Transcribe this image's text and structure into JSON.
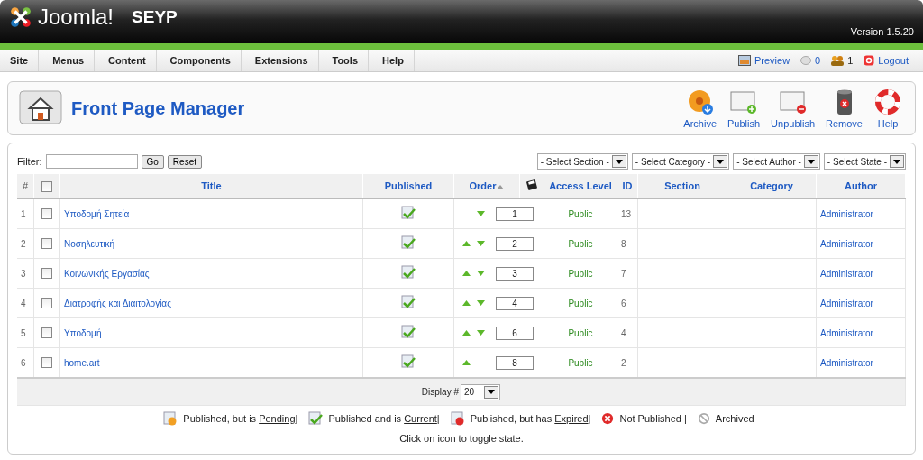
{
  "header": {
    "brand": "Joomla!",
    "site": "SEYP",
    "version": "Version 1.5.20"
  },
  "menu": [
    "Site",
    "Menus",
    "Content",
    "Components",
    "Extensions",
    "Tools",
    "Help"
  ],
  "status": {
    "preview": "Preview",
    "messages": "0",
    "users": "1",
    "logout": "Logout"
  },
  "toolbar": {
    "title": "Front Page Manager",
    "buttons": [
      {
        "kind": "archive",
        "label": "Archive"
      },
      {
        "kind": "publish",
        "label": "Publish"
      },
      {
        "kind": "unpublish",
        "label": "Unpublish"
      },
      {
        "kind": "remove",
        "label": "Remove"
      },
      {
        "kind": "help",
        "label": "Help"
      }
    ]
  },
  "filter": {
    "label": "Filter:",
    "go": "Go",
    "reset": "Reset",
    "selects": [
      "- Select Section -",
      "- Select Category -",
      "- Select Author -",
      "- Select State -"
    ]
  },
  "table": {
    "select_all_checked": false,
    "columns": [
      "#",
      "Title",
      "Published",
      "Order",
      "Access Level",
      "ID",
      "Section",
      "Category",
      "Author"
    ],
    "rows": [
      {
        "num": "1",
        "checked": false,
        "title": "Υποδομή Σητεία",
        "published": true,
        "can_move_up": false,
        "can_move_down": true,
        "order": "1",
        "access": "Public",
        "id": "13",
        "author": "Administrator"
      },
      {
        "num": "2",
        "checked": false,
        "title": "Νοσηλευτική",
        "published": true,
        "can_move_up": true,
        "can_move_down": true,
        "order": "2",
        "access": "Public",
        "id": "8",
        "author": "Administrator"
      },
      {
        "num": "3",
        "checked": false,
        "title": "Κοινωνικής Εργασίας",
        "published": true,
        "can_move_up": true,
        "can_move_down": true,
        "order": "3",
        "access": "Public",
        "id": "7",
        "author": "Administrator"
      },
      {
        "num": "4",
        "checked": false,
        "title": "Διατροφής και Διαιτολογίας",
        "published": true,
        "can_move_up": true,
        "can_move_down": true,
        "order": "4",
        "access": "Public",
        "id": "6",
        "author": "Administrator"
      },
      {
        "num": "5",
        "checked": false,
        "title": "Υποδομή",
        "published": true,
        "can_move_up": true,
        "can_move_down": true,
        "order": "6",
        "access": "Public",
        "id": "4",
        "author": "Administrator"
      },
      {
        "num": "6",
        "checked": false,
        "title": "home.art",
        "published": true,
        "can_move_up": true,
        "can_move_down": false,
        "order": "8",
        "access": "Public",
        "id": "2",
        "author": "Administrator"
      }
    ],
    "display_label": "Display #",
    "display_value": "20"
  },
  "legend": [
    {
      "kind": "pending",
      "text": "Published, but is ",
      "link": "Pending",
      "sep": "|"
    },
    {
      "kind": "current",
      "text": "Published and is ",
      "link": "Current",
      "sep": "|"
    },
    {
      "kind": "expired",
      "text": "Published, but has ",
      "link": "Expired",
      "sep": "|"
    },
    {
      "kind": "unpublished",
      "text": "Not Published ",
      "sep": "|"
    },
    {
      "kind": "archived",
      "text": "Archived"
    }
  ],
  "hint": "Click on icon to toggle state."
}
